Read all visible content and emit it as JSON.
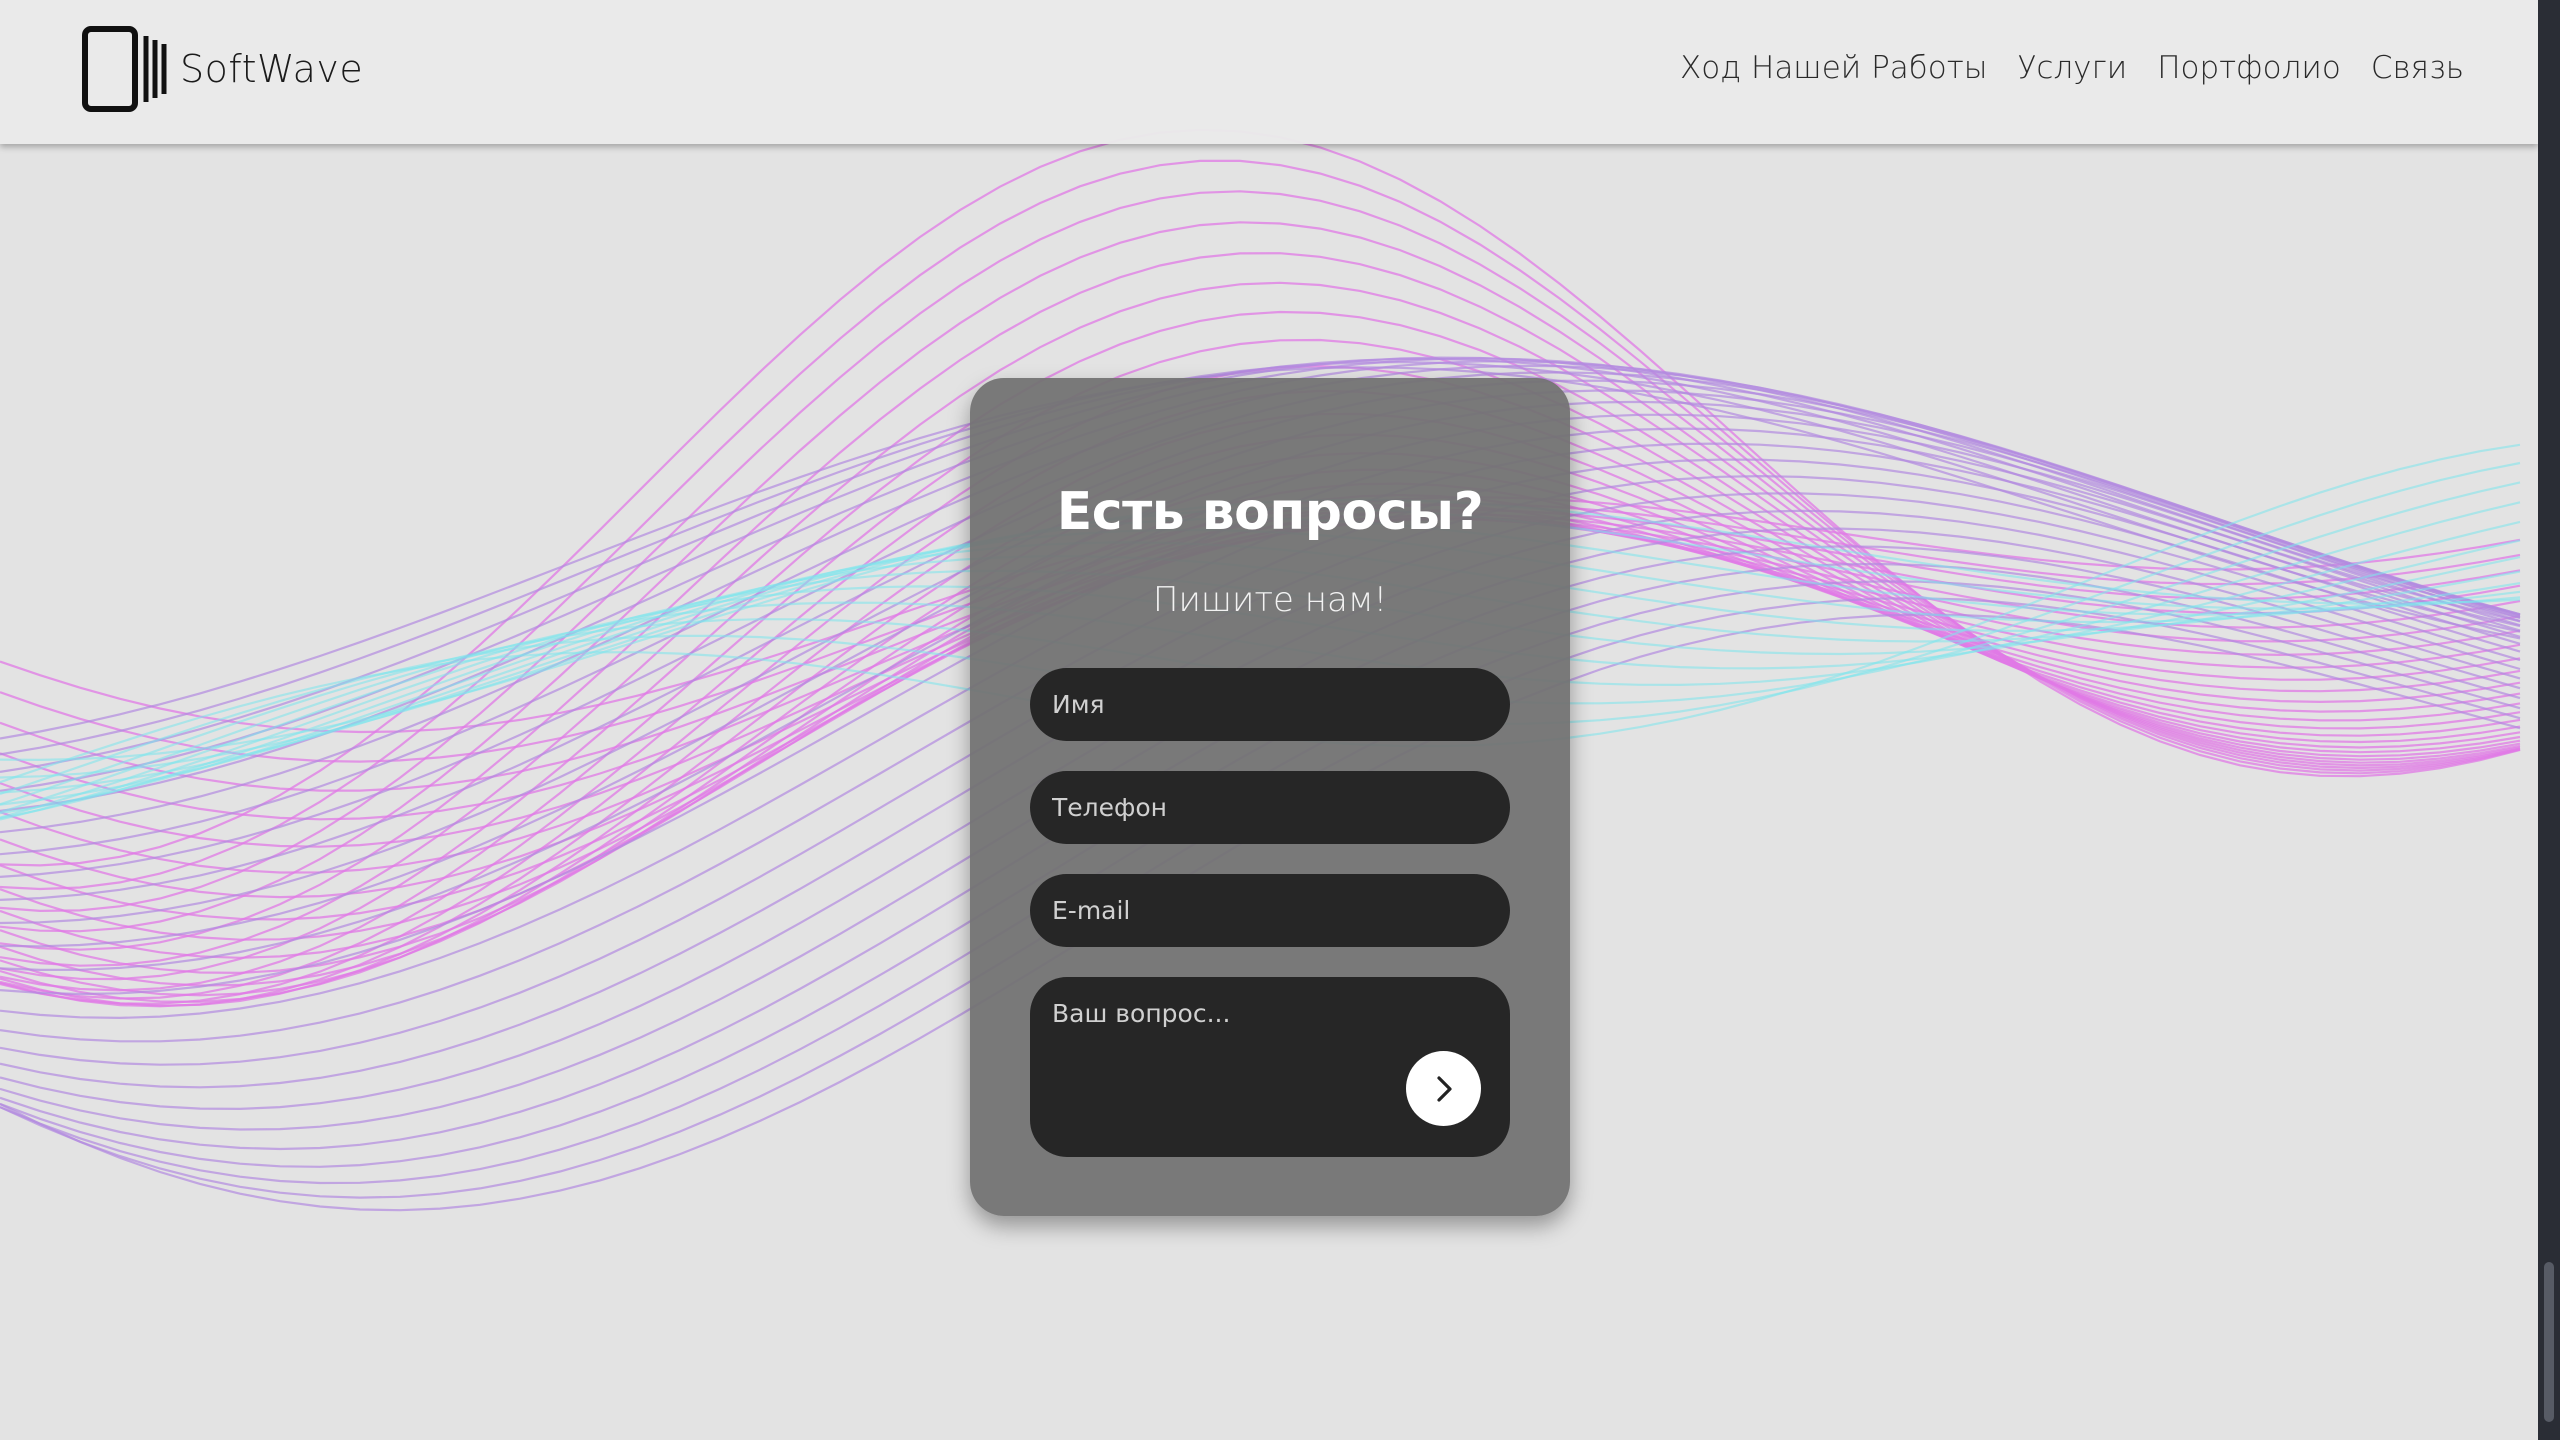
{
  "header": {
    "brand": "SoftWave",
    "logo_icon": "tablet-waves-logo",
    "nav": [
      {
        "label": "Ход Нашей Работы"
      },
      {
        "label": "Услуги"
      },
      {
        "label": "Портфолио"
      },
      {
        "label": "Связь"
      }
    ]
  },
  "contact": {
    "title": "Есть вопросы?",
    "subtitle": "Пишите нам!",
    "name_placeholder": "Имя",
    "phone_placeholder": "Телефон",
    "email_placeholder": "E-mail",
    "question_placeholder": "Ваш вопрос...",
    "submit_icon": "chevron-right-icon"
  },
  "colors": {
    "wave_pink": "#e07ae6",
    "wave_purple": "#b28ae0",
    "wave_cyan": "#7ce6ec",
    "card_bg": "#727272",
    "field_bg": "#262626"
  }
}
